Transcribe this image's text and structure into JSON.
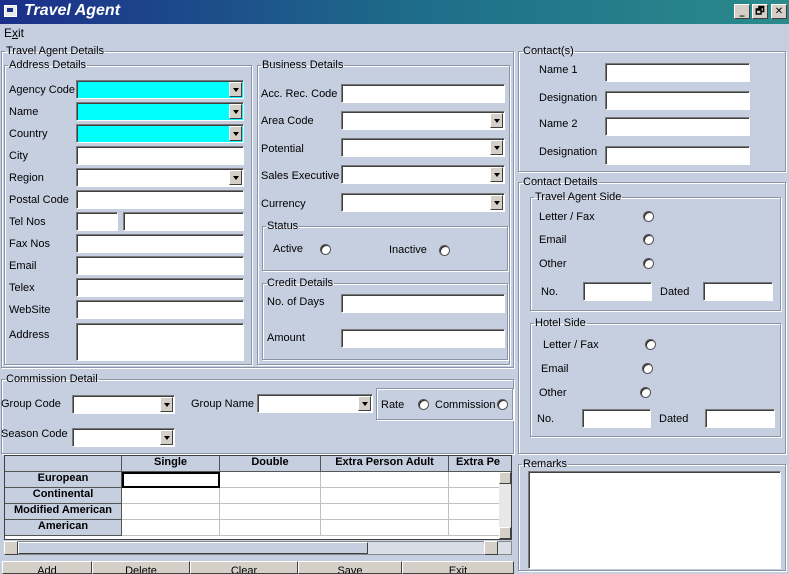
{
  "window": {
    "title": "Travel Agent",
    "min": "_",
    "max": "🗗",
    "close": "✕"
  },
  "menu": {
    "exit": "Exit"
  },
  "travel_agent_details": {
    "legend": "Travel Agent Details",
    "address": {
      "legend": "Address Details",
      "agency_code": "Agency Code",
      "name": "Name",
      "country": "Country",
      "city": "City",
      "region": "Region",
      "postal_code": "Postal Code",
      "tel_nos": "Tel Nos",
      "fax_nos": "Fax Nos",
      "email": "Email",
      "telex": "Telex",
      "website": "WebSite",
      "address": "Address"
    },
    "business": {
      "legend": "Business Details",
      "acc_rec_code": "Acc. Rec. Code",
      "area_code": "Area Code",
      "potential": "Potential",
      "sales_executive": "Sales Executive",
      "currency": "Currency"
    },
    "status": {
      "legend": "Status",
      "active": "Active",
      "inactive": "Inactive"
    },
    "credit": {
      "legend": "Credit Details",
      "no_of_days": "No. of Days",
      "amount": "Amount"
    }
  },
  "contacts": {
    "legend": "Contact(s)",
    "name1": "Name 1",
    "designation1": "Designation",
    "name2": "Name 2",
    "designation2": "Designation"
  },
  "contact_details": {
    "legend": "Contact Details",
    "travel_agent_side": {
      "legend": "Travel Agent Side",
      "letter_fax": "Letter / Fax",
      "email": "Email",
      "other": "Other",
      "no": "No.",
      "dated": "Dated"
    },
    "hotel_side": {
      "legend": "Hotel Side",
      "letter_fax": "Letter / Fax",
      "email": "Email",
      "other": "Other",
      "no": "No.",
      "dated": "Dated"
    }
  },
  "commission": {
    "legend": "Commission Detail",
    "group_code": "Group Code",
    "group_name": "Group Name",
    "rate": "Rate",
    "commission": "Commission",
    "season_code": "Season Code"
  },
  "grid": {
    "columns": [
      "Single",
      "Double",
      "Extra Person Adult",
      "Extra Pe"
    ],
    "rows": [
      "European",
      "Continental",
      "Modified American",
      "American"
    ]
  },
  "remarks": {
    "legend": "Remarks"
  },
  "buttons": [
    "Add",
    "Delete",
    "Clear",
    "Save",
    "Exit"
  ]
}
